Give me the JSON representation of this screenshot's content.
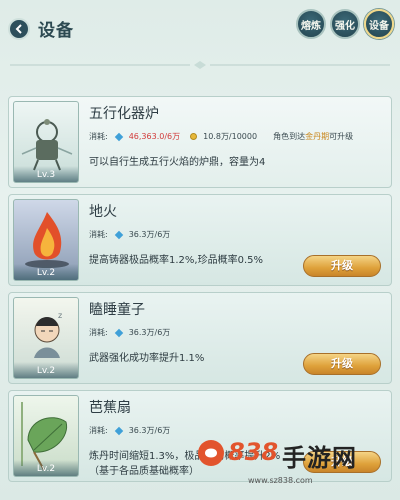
{
  "header": {
    "title": "设备",
    "tabs": [
      {
        "label": "熔炼",
        "active": false
      },
      {
        "label": "强化",
        "active": false
      },
      {
        "label": "设备",
        "active": true
      }
    ]
  },
  "cost_label": "消耗:",
  "items": [
    {
      "name": "五行化器炉",
      "level": "Lv.3",
      "gem_cost": "46,363.0/6万",
      "coin_cost": "10.8万/10000",
      "hint_prefix": "角色到达",
      "hint_highlight": "金丹期",
      "hint_suffix": "可升级",
      "desc": "可以自行生成五行火焰的炉鼎，容量为4"
    },
    {
      "name": "地火",
      "level": "Lv.2",
      "gem_cost": "36.3万/6万",
      "desc": "提高铸器极品概率1.2%,珍品概率0.5%",
      "button": "升级"
    },
    {
      "name": "瞌睡童子",
      "level": "Lv.2",
      "gem_cost": "36.3万/6万",
      "desc": "武器强化成功率提升1.1%",
      "button": "升级"
    },
    {
      "name": "芭蕉扇",
      "level": "Lv.2",
      "gem_cost": "36.3万/6万",
      "desc": "炼丹时间缩短1.3%，极品丹药概率提升2%（基于各品质基础概率）",
      "button": "升级"
    }
  ],
  "watermark": {
    "num": "838",
    "text": "手游网",
    "url": "www.sz838.com"
  }
}
